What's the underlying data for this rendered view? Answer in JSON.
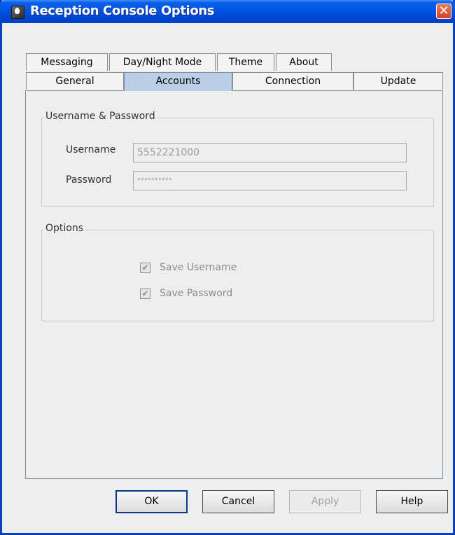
{
  "window": {
    "title": "Reception Console Options",
    "close_glyph": "✕"
  },
  "tabs": {
    "row1": [
      {
        "label": "Messaging"
      },
      {
        "label": "Day/Night Mode"
      },
      {
        "label": "Theme"
      },
      {
        "label": "About"
      }
    ],
    "row2": [
      {
        "label": "General"
      },
      {
        "label": "Accounts",
        "selected": true
      },
      {
        "label": "Connection"
      },
      {
        "label": "Update"
      }
    ]
  },
  "credentials": {
    "title": "Username & Password",
    "username_label": "Username",
    "username_value": "5552221000",
    "password_label": "Password",
    "password_value": "**********"
  },
  "options": {
    "title": "Options",
    "save_username": {
      "label": "Save Username",
      "checked": true
    },
    "save_password": {
      "label": "Save Password",
      "checked": true
    },
    "check_glyph": "✔"
  },
  "buttons": {
    "ok": "OK",
    "cancel": "Cancel",
    "apply": "Apply",
    "help": "Help"
  },
  "colors": {
    "titlebar": "#0054e3",
    "selected_tab": "#b8cfe5",
    "close_button": "#d5421f",
    "window_bg": "#eeeeee"
  }
}
